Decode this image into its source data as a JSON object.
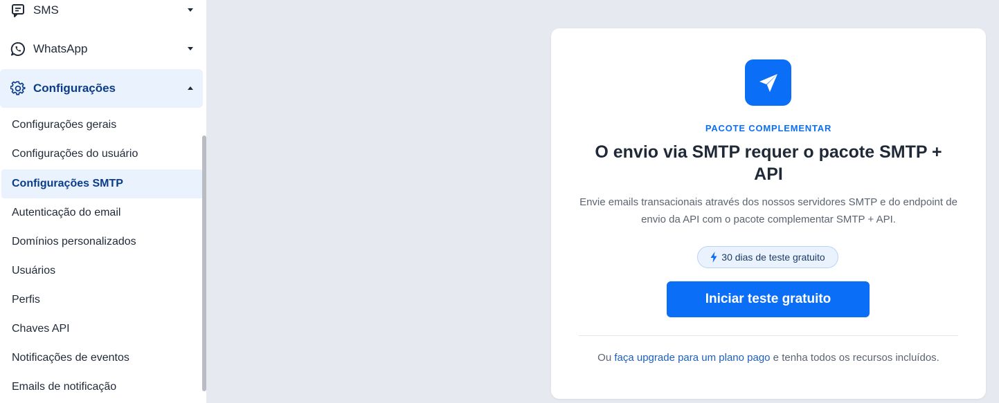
{
  "sidebar": {
    "top_items": [
      {
        "label": "SMS",
        "icon": "chat-icon"
      },
      {
        "label": "WhatsApp",
        "icon": "whatsapp-icon"
      },
      {
        "label": "Configurações",
        "icon": "gear-icon"
      }
    ],
    "sub_items": [
      {
        "label": "Configurações gerais"
      },
      {
        "label": "Configurações do usuário"
      },
      {
        "label": "Configurações SMTP"
      },
      {
        "label": "Autenticação do email"
      },
      {
        "label": "Domínios personalizados"
      },
      {
        "label": "Usuários"
      },
      {
        "label": "Perfis"
      },
      {
        "label": "Chaves API"
      },
      {
        "label": "Notificações de eventos"
      },
      {
        "label": "Emails de notificação"
      }
    ]
  },
  "card": {
    "kicker": "PACOTE COMPLEMENTAR",
    "title": "O envio via SMTP requer o pacote SMTP + API",
    "description": "Envie emails transacionais através dos nossos servidores SMTP e do endpoint de envio da API com o pacote complementar SMTP + API.",
    "trial_badge": "30 dias de teste gratuito",
    "cta_label": "Iniciar teste gratuito",
    "footer_prefix": "Ou ",
    "footer_link": "faça upgrade para um plano pago",
    "footer_suffix": " e tenha todos os recursos incluídos."
  },
  "colors": {
    "accent": "#0b6ef6",
    "active_bg": "#eaf2fd",
    "active_text": "#0b3c8a",
    "page_bg": "#e6e9f0"
  }
}
